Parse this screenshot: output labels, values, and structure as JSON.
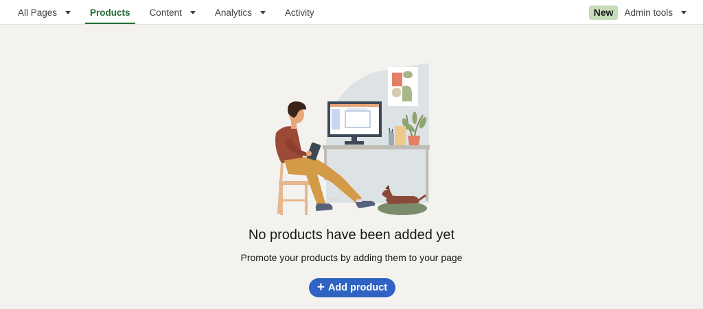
{
  "nav": {
    "items": [
      {
        "label": "All Pages",
        "has_caret": true,
        "active": false
      },
      {
        "label": "Products",
        "has_caret": false,
        "active": true
      },
      {
        "label": "Content",
        "has_caret": true,
        "active": false
      },
      {
        "label": "Analytics",
        "has_caret": true,
        "active": false
      },
      {
        "label": "Activity",
        "has_caret": false,
        "active": false
      }
    ],
    "new_badge": "New",
    "admin_tools": "Admin tools"
  },
  "empty_state": {
    "title": "No products have been added yet",
    "subtitle": "Promote your products by adding them to your page",
    "button_label": "Add product",
    "button_icon": "plus-icon"
  },
  "colors": {
    "active_tab": "#1f6b34",
    "primary_button": "#2f62c3",
    "new_badge": "#c7dcb8",
    "background": "#f3f2ef"
  }
}
